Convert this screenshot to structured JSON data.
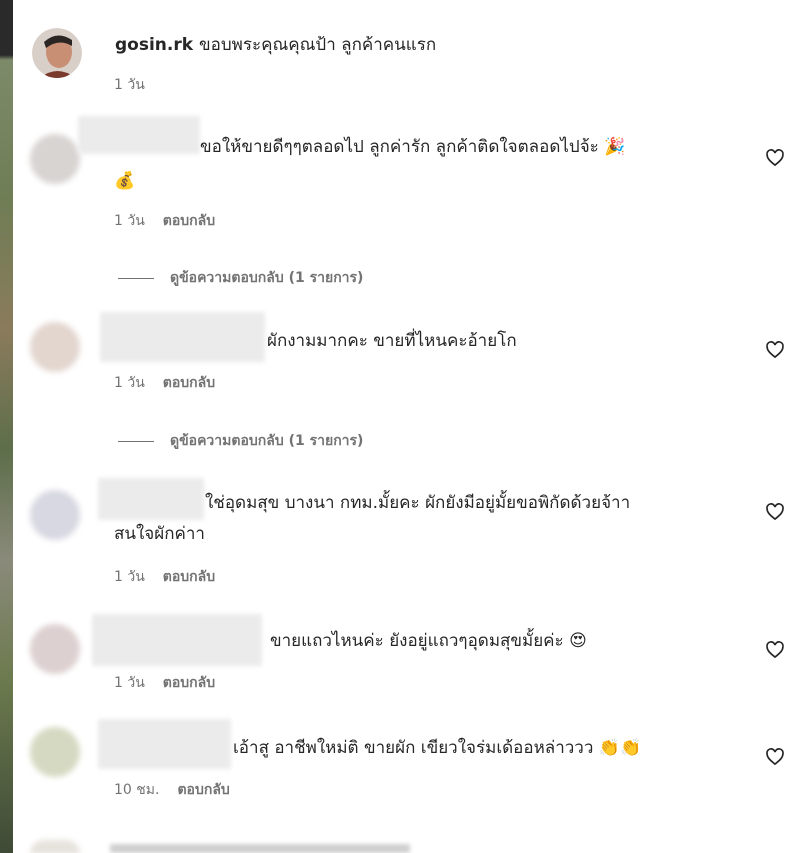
{
  "comments": [
    {
      "username": "gosin.rk",
      "text": "ขอบพระคุณคุณป้า ลูกค้าคนแรก",
      "time": "1 วัน",
      "reply_label": ""
    },
    {
      "username": "",
      "text": "ขอให้ขายดีๆๆตลอดไป ลูกค่ารัก ลูกค้าติดใจตลอดไปจ้ะ 🎉",
      "text2": "💰",
      "time": "1 วัน",
      "reply_label": "ตอบกลับ",
      "view_replies": "ดูข้อความตอบกลับ (1 รายการ)"
    },
    {
      "username": "",
      "text": "ผักงามมากคะ ขายที่ไหนคะอ้ายโก",
      "time": "1 วัน",
      "reply_label": "ตอบกลับ",
      "view_replies": "ดูข้อความตอบกลับ (1 รายการ)"
    },
    {
      "username": "",
      "text": "ใช่อุดมสุข บางนา กทม.มั้ยคะ ผักยังมีอยู่มั้ยขอพิกัดด้วยจ้าา",
      "text2": "สนใจผักค่าา",
      "time": "1 วัน",
      "reply_label": "ตอบกลับ"
    },
    {
      "username": "",
      "text": "ขายแถวไหนค่ะ ยังอยู่แถวๆอุดมสุขมั้ยค่ะ 😍",
      "time": "1 วัน",
      "reply_label": "ตอบกลับ"
    },
    {
      "username": "",
      "text": "เอ้าสู อาชีพใหม่ติ ขายผัก เขียวใจร่มเด้ออหล่าววว 👏👏",
      "time": "10 ชม.",
      "reply_label": "ตอบกลับ"
    }
  ],
  "icons": {
    "heart": "heart-icon"
  },
  "colors": {
    "text": "#262626",
    "meta": "#737373"
  }
}
